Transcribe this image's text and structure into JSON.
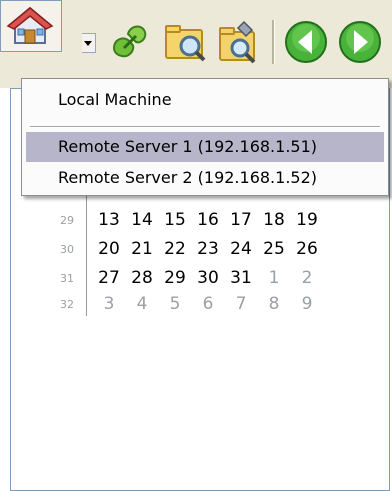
{
  "toolbar": {
    "buttons": [
      {
        "name": "home",
        "icon": "home-icon"
      },
      {
        "name": "connect",
        "icon": "connect-icon"
      },
      {
        "name": "search",
        "icon": "folder-search-icon"
      },
      {
        "name": "scan",
        "icon": "scan-icon"
      },
      {
        "name": "back",
        "icon": "green-left-arrow-icon"
      },
      {
        "name": "forward",
        "icon": "green-right-arrow-icon"
      }
    ]
  },
  "dropdown_menu": {
    "items": [
      {
        "label": "Local Machine",
        "highlighted": false
      },
      {
        "label": "Remote Server 1 (192.168.1.51)",
        "highlighted": true
      },
      {
        "label": "Remote Server 2 (192.168.1.52)",
        "highlighted": false
      }
    ]
  },
  "calendar": {
    "weeks": [
      {
        "week": "29",
        "days": [
          "13",
          "14",
          "15",
          "16",
          "17",
          "18",
          "19"
        ]
      },
      {
        "week": "30",
        "days": [
          "20",
          "21",
          "22",
          "23",
          "24",
          "25",
          "26"
        ]
      },
      {
        "week": "31",
        "days": [
          "27",
          "28",
          "29",
          "30",
          "31",
          "1",
          "2"
        ]
      },
      {
        "week": "32",
        "days": [
          "3",
          "4",
          "5",
          "6",
          "7",
          "8",
          "9"
        ]
      }
    ]
  }
}
